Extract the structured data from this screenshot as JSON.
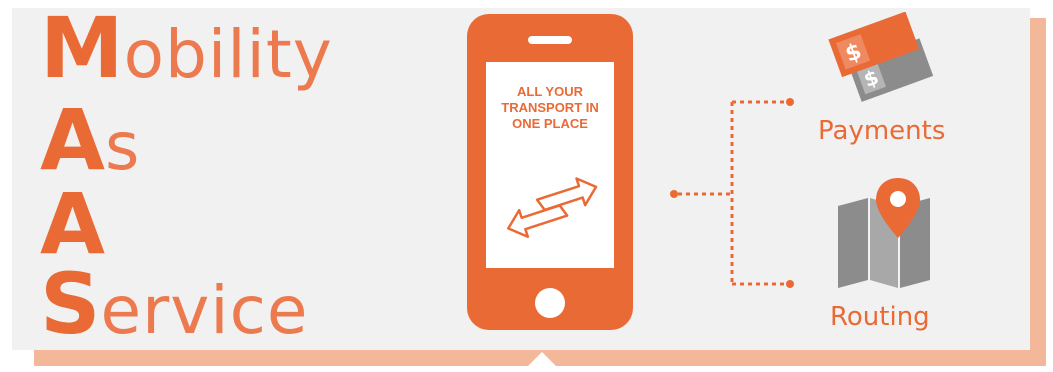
{
  "acronym_words": [
    {
      "cap": "M",
      "rest": "obility"
    },
    {
      "cap": "A",
      "rest": "s"
    },
    {
      "cap": "A",
      "rest": ""
    },
    {
      "cap": "S",
      "rest": "ervice"
    }
  ],
  "phone": {
    "screen_lines": [
      "ALL YOUR",
      "TRANSPORT IN",
      "ONE PLACE"
    ],
    "screen_icon": "exchange-arrows-icon"
  },
  "features": {
    "payments": {
      "label": "Payments",
      "icon": "money-icon"
    },
    "routing": {
      "label": "Routing",
      "icon": "map-pin-icon"
    }
  },
  "colors": {
    "accent": "#ea6a35",
    "panel": "#f1f1f1",
    "shadow": "#f3b79a",
    "icon_gray": "#8c8c8c"
  }
}
